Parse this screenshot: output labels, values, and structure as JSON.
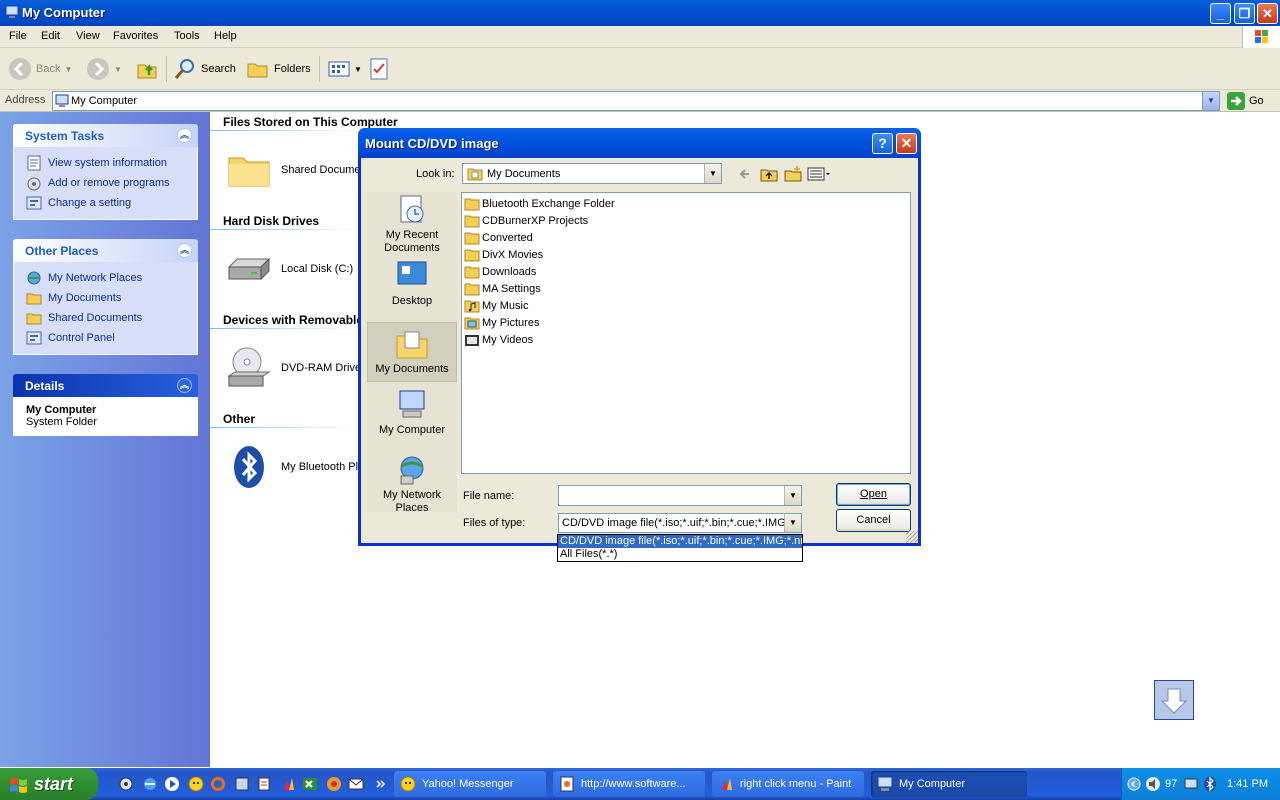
{
  "window": {
    "title": "My Computer"
  },
  "menu": [
    "File",
    "Edit",
    "View",
    "Favorites",
    "Tools",
    "Help"
  ],
  "toolbar": {
    "back": "Back",
    "search": "Search",
    "folders": "Folders"
  },
  "address": {
    "label": "Address",
    "value": "My Computer",
    "go": "Go"
  },
  "tasks": {
    "system": {
      "title": "System Tasks",
      "items": [
        "View system information",
        "Add or remove programs",
        "Change a setting"
      ]
    },
    "other": {
      "title": "Other Places",
      "items": [
        "My Network Places",
        "My Documents",
        "Shared Documents",
        "Control Panel"
      ]
    },
    "details": {
      "title": "Details",
      "name": "My Computer",
      "type": "System Folder"
    }
  },
  "content": {
    "groups": [
      "Files Stored on This Computer",
      "Hard Disk Drives",
      "Devices with Removable",
      "Other"
    ],
    "items": [
      "Shared Documer",
      "Local Disk (C:)",
      "DVD-RAM Drive (",
      "My Bluetooth Pla"
    ]
  },
  "dialog": {
    "title": "Mount CD/DVD image",
    "look_in_label": "Look in:",
    "look_in_value": "My Documents",
    "places": [
      "My Recent Documents",
      "Desktop",
      "My Documents",
      "My Computer",
      "My Network Places"
    ],
    "files": [
      "Bluetooth Exchange Folder",
      "CDBurnerXP Projects",
      "Converted",
      "DivX Movies",
      "Downloads",
      "MA Settings",
      "My Music",
      "My Pictures",
      "My Videos"
    ],
    "file_name_label": "File name:",
    "file_name_value": "",
    "files_of_type_label": "Files of type:",
    "files_of_type_value": "CD/DVD image file(*.iso;*.uif;*.bin;*.cue;*.IMG;*.nrg",
    "type_options": [
      "CD/DVD image file(*.iso;*.uif;*.bin;*.cue;*.IMG;*.nrg",
      "All Files(*.*)"
    ],
    "open_label": "Open",
    "cancel_label": "Cancel"
  },
  "taskbar": {
    "start": "start",
    "tasks": [
      "Yahoo! Messenger",
      "http://www.software...",
      "right click menu - Paint",
      "My Computer"
    ],
    "tray_value": "97",
    "clock": "1:41 PM"
  },
  "colors": {
    "xp_blue": "#0053e1",
    "task_pane": "#6375d6",
    "selection": "#316ac5",
    "start_green": "#2f8f2f"
  }
}
